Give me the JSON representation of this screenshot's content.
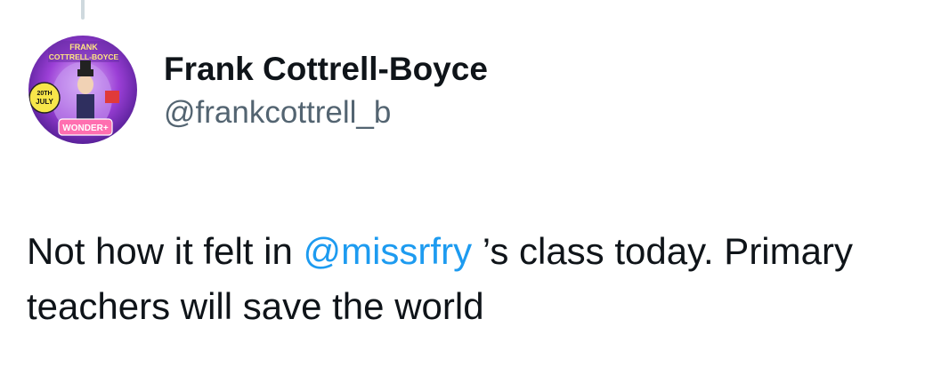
{
  "author": {
    "display_name": "Frank Cottrell-Boyce",
    "handle": "@frankcottrell_b",
    "avatar": {
      "icon": "book-cover-avatar",
      "lines": [
        "FRANK",
        "COTTRELL-BOYCE",
        "20TH",
        "JULY",
        "WONDER+"
      ]
    }
  },
  "tweet": {
    "text_before": "Not how it felt in ",
    "mention": "@missrfry",
    "text_after": " ’s class today. Primary teachers will save the world"
  },
  "colors": {
    "text": "#0f1419",
    "secondary": "#536471",
    "link": "#1d9bf0",
    "thread_line": "#cfd9de"
  }
}
